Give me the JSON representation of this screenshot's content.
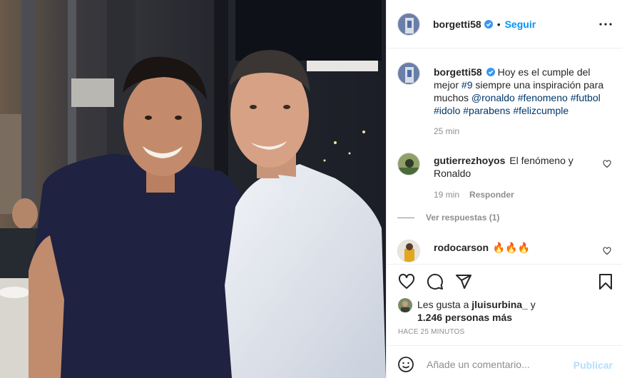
{
  "post": {
    "author": "borgetti58",
    "follow_label": "Seguir",
    "separator": "•",
    "caption": {
      "text_1": "Hoy es el cumple del mejor ",
      "tag_1": "#9",
      "text_2": " siempre una inspiración para muchos ",
      "mention": "@ronaldo",
      "tag_2": "#fenomeno",
      "tag_3": "#futbol",
      "tag_4": "#idolo",
      "tag_5": "#parabens",
      "tag_6": "#felizcumple",
      "age": "25 min"
    },
    "comments": [
      {
        "user": "gutierrezhoyos",
        "text": "El fenómeno y Ronaldo",
        "age": "19 min",
        "reply_label": "Responder",
        "view_replies": "Ver respuestas (1)"
      },
      {
        "user": "rodocarson",
        "text": "🔥🔥🔥"
      }
    ],
    "likes": {
      "prefix": "Les gusta a",
      "user": "jluisurbina_",
      "suffix": "y",
      "others": "1.246 personas más"
    },
    "timestamp": "Hace 25 minutos",
    "add_comment_placeholder": "Añade un comentario...",
    "publish_label": "Publicar"
  },
  "colors": {
    "link_blue": "#0095f6",
    "hashtag": "#00376b",
    "muted": "#8e8e8e",
    "publish_disabled": "#b2dffc"
  },
  "icons": [
    "verified-badge-icon",
    "more-options-icon",
    "heart-icon",
    "comment-icon",
    "share-icon",
    "bookmark-icon",
    "emoji-icon"
  ]
}
